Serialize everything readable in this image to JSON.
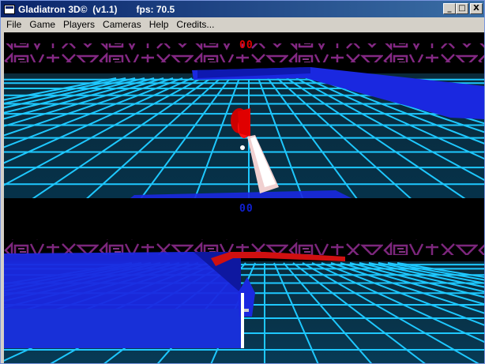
{
  "window": {
    "title": "Gladiatron 3D©  (v1.1)",
    "fps_label": "fps: 70.5",
    "minimize": "_",
    "maximize": "□",
    "close": "X"
  },
  "menu": {
    "items": [
      "File",
      "Game",
      "Players",
      "Cameras",
      "Help",
      "Credits..."
    ]
  },
  "game": {
    "player1_score": "00",
    "player2_score": "00",
    "colors": {
      "grid": "#1ec8ff",
      "player1": "#e00000",
      "player2": "#1a28e0",
      "banner": "#8a2a8a"
    }
  }
}
